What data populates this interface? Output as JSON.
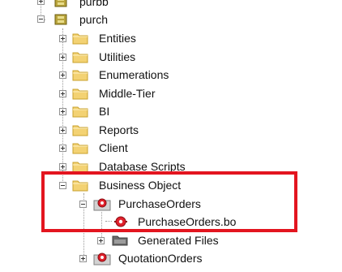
{
  "tree": {
    "top_item": "purbb",
    "package": "purch",
    "folders": [
      "Entities",
      "Utilities",
      "Enumerations",
      "Middle-Tier",
      "BI",
      "Reports",
      "Client",
      "Database Scripts",
      "Business Object"
    ],
    "business_object_children": {
      "object": "PurchaseOrders",
      "file": "PurchaseOrders.bo",
      "generated": "Generated Files"
    },
    "next_object": "QuotationOrders"
  },
  "highlight_color": "#e3151f",
  "icons": [
    "package-icon",
    "folder-icon",
    "business-object-icon",
    "gray-folder-icon"
  ]
}
